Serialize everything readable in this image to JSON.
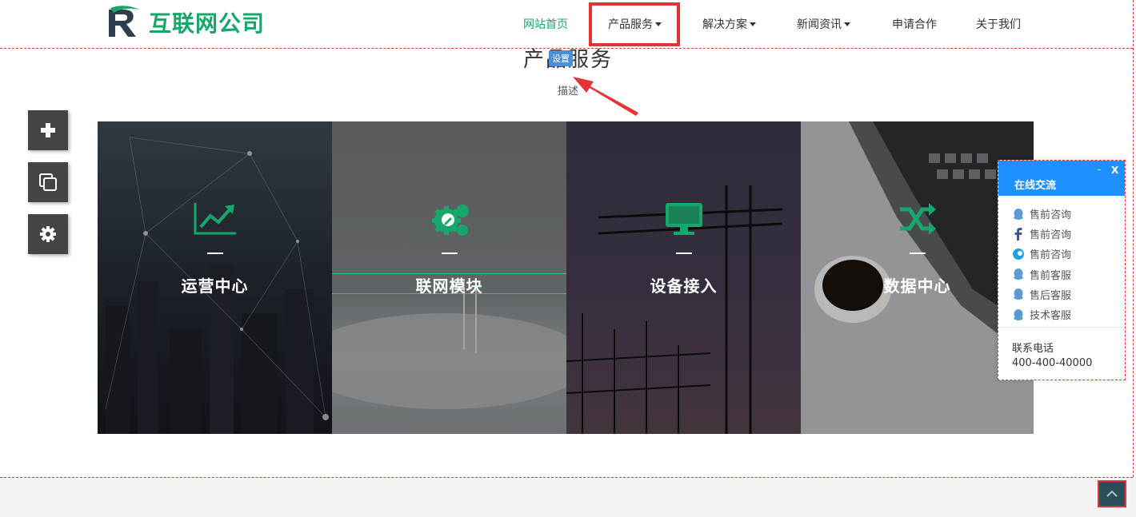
{
  "header": {
    "logo_text": "互联网公司",
    "nav": [
      {
        "label": "网站首页",
        "active": true,
        "dropdown": false
      },
      {
        "label": "产品服务",
        "active": false,
        "dropdown": true
      },
      {
        "label": "解决方案",
        "active": false,
        "dropdown": true
      },
      {
        "label": "新闻资讯",
        "active": false,
        "dropdown": true
      },
      {
        "label": "申请合作",
        "active": false,
        "dropdown": false
      },
      {
        "label": "关于我们",
        "active": false,
        "dropdown": false
      }
    ]
  },
  "section": {
    "title": "产品服务",
    "badge": "设置",
    "description": "描述"
  },
  "tools": [
    {
      "icon": "plus-icon"
    },
    {
      "icon": "copy-icon"
    },
    {
      "icon": "gear-icon"
    }
  ],
  "cards": [
    {
      "title": "运营中心",
      "icon": "chart-trend-icon"
    },
    {
      "title": "联网模块",
      "icon": "gears-edit-icon"
    },
    {
      "title": "设备接入",
      "icon": "monitor-icon"
    },
    {
      "title": "数据中心",
      "icon": "shuffle-icon"
    }
  ],
  "chat": {
    "title": "在线交流",
    "minimize": "-",
    "close": "X",
    "items": [
      {
        "label": "售前咨询",
        "icon": "qq-icon"
      },
      {
        "label": "售前咨询",
        "icon": "facebook-icon"
      },
      {
        "label": "售前咨询",
        "icon": "aliwangwang-icon"
      },
      {
        "label": "售前客服",
        "icon": "qq-icon"
      },
      {
        "label": "售后客服",
        "icon": "qq-icon"
      },
      {
        "label": "技术客服",
        "icon": "qq-icon"
      }
    ],
    "phone_label": "联系电话",
    "phone": "400-400-40000"
  },
  "colors": {
    "brand": "#15a86a",
    "chat_header": "#1e90ff",
    "highlight": "#e53333"
  }
}
